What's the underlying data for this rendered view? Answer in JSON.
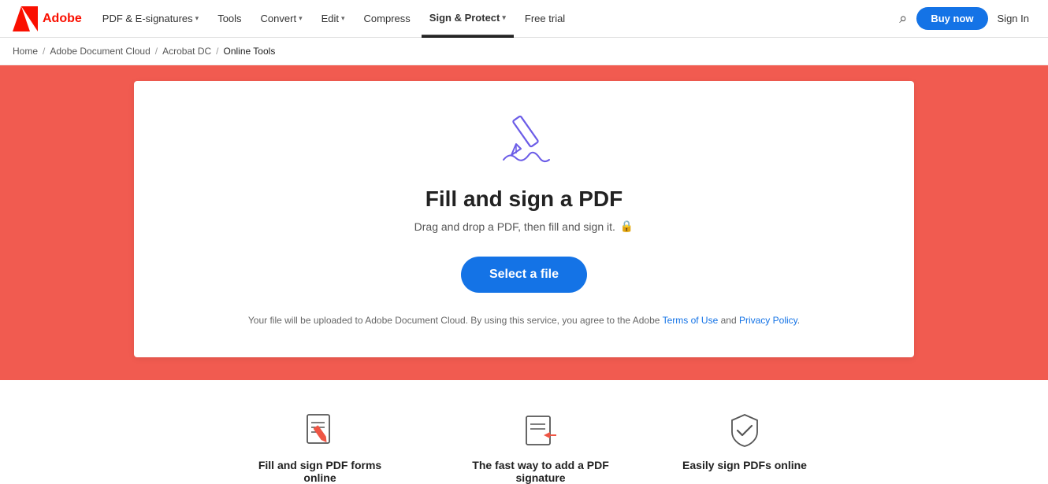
{
  "nav": {
    "logo_alt": "Adobe",
    "items": [
      {
        "label": "PDF & E-signatures",
        "has_dropdown": true,
        "active": false
      },
      {
        "label": "Tools",
        "has_dropdown": false,
        "active": false
      },
      {
        "label": "Convert",
        "has_dropdown": true,
        "active": false
      },
      {
        "label": "Edit",
        "has_dropdown": true,
        "active": false
      },
      {
        "label": "Compress",
        "has_dropdown": false,
        "active": false
      },
      {
        "label": "Sign & Protect",
        "has_dropdown": true,
        "active": true
      },
      {
        "label": "Free trial",
        "has_dropdown": false,
        "active": false
      }
    ],
    "buy_now_label": "Buy now",
    "search_icon": "🔍",
    "signin_label": "Sign In"
  },
  "breadcrumb": {
    "items": [
      {
        "label": "Home",
        "link": true
      },
      {
        "label": "Adobe Document Cloud",
        "link": true
      },
      {
        "label": "Acrobat DC",
        "link": true
      },
      {
        "label": "Online Tools",
        "link": false
      }
    ]
  },
  "hero": {
    "title": "Fill and sign a PDF",
    "subtitle": "Drag and drop a PDF, then fill and sign it.",
    "select_file_label": "Select a file",
    "disclaimer_prefix": "Your file will be uploaded to Adobe Document Cloud.  By using this service, you agree to the Adobe ",
    "terms_label": "Terms of Use",
    "disclaimer_and": " and ",
    "privacy_label": "Privacy Policy",
    "disclaimer_suffix": "."
  },
  "features": [
    {
      "label": "Fill and sign PDF forms online"
    },
    {
      "label": "The fast way to add a PDF signature"
    },
    {
      "label": "Easily sign PDFs online"
    }
  ]
}
